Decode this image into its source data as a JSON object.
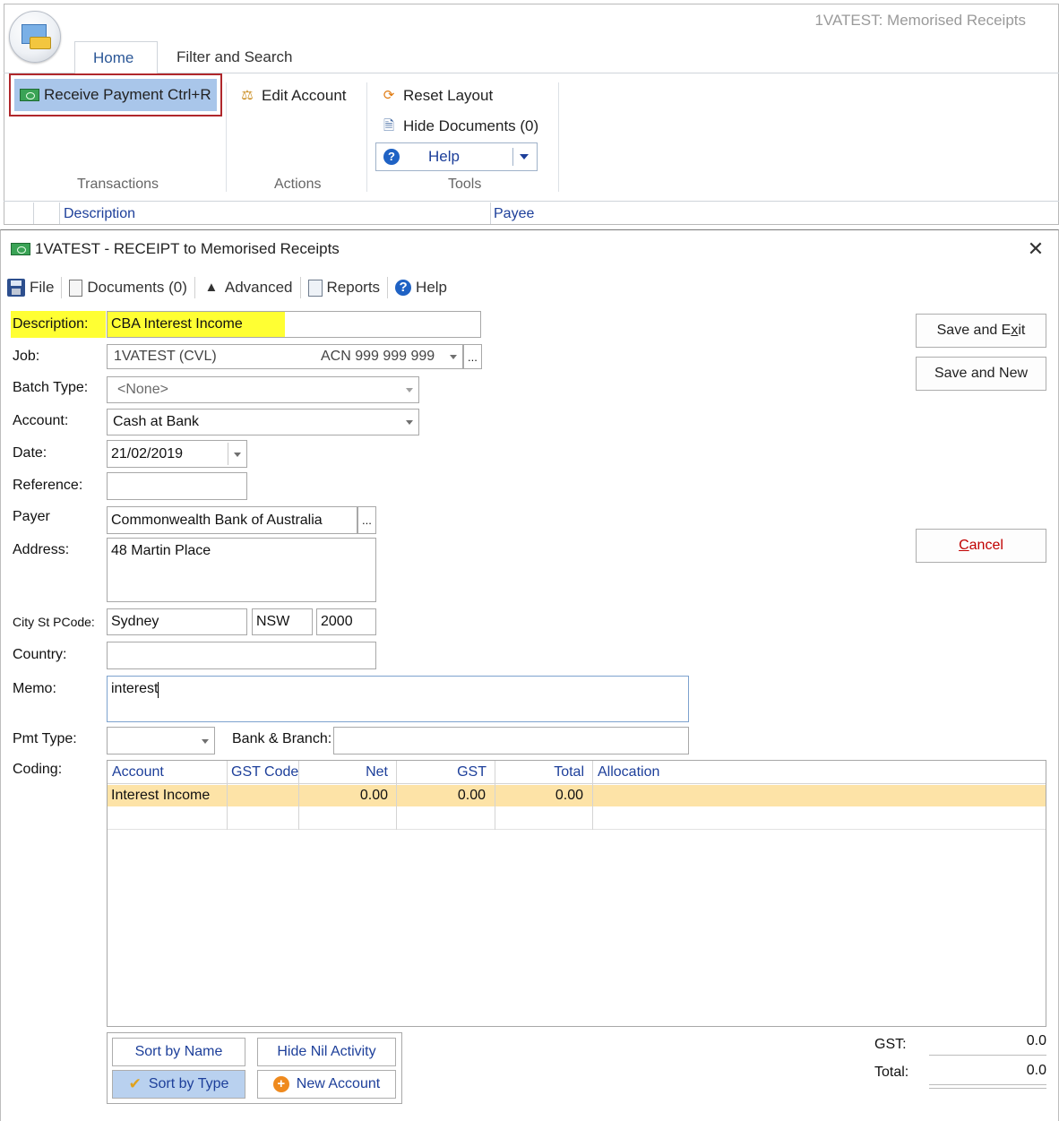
{
  "app": {
    "title": "1VATEST: Memorised Receipts",
    "tabs": [
      "Home",
      "Filter and Search"
    ],
    "ribbon": {
      "receive_payment": "Receive Payment Ctrl+R",
      "edit_account": "Edit Account",
      "reset_layout": "Reset Layout",
      "hide_documents": "Hide Documents (0)",
      "help": "Help",
      "groups": [
        "Transactions",
        "Actions",
        "Tools"
      ]
    },
    "grid_columns": [
      "Description",
      "Payee"
    ]
  },
  "dialog": {
    "title": "1VATEST - RECEIPT to Memorised Receipts",
    "toolbar": [
      "File",
      "Documents (0)",
      "Advanced",
      "Reports",
      "Help"
    ],
    "labels": {
      "description": "Description:",
      "job": "Job:",
      "batch_type": "Batch Type:",
      "account": "Account:",
      "date": "Date:",
      "reference": "Reference:",
      "payer": "Payer",
      "address": "Address:",
      "city_st_pcode": "City St PCode:",
      "country": "Country:",
      "memo": "Memo:",
      "pmt_type": "Pmt Type:",
      "bank_branch": "Bank & Branch:",
      "coding": "Coding:"
    },
    "values": {
      "description": "CBA Interest Income",
      "job_name": "1VATEST (CVL)",
      "job_acn": "ACN 999 999 999",
      "batch_type": "<None>",
      "account": "Cash at Bank",
      "date": "21/02/2019",
      "reference": "",
      "payer": "Commonwealth Bank of Australia",
      "address": "48 Martin Place",
      "city": "Sydney",
      "state": "NSW",
      "postcode": "2000",
      "country": "",
      "memo": "interest",
      "pmt_type": "",
      "bank_branch": ""
    },
    "buttons": {
      "save_exit_pre": "Save and E",
      "save_exit_u": "x",
      "save_exit_post": "it",
      "save_new": "Save and New",
      "cancel_u": "C",
      "cancel_post": "ancel",
      "ellipsis": "..."
    },
    "coding": {
      "columns": [
        "Account",
        "GST Code",
        "Net",
        "GST",
        "Total",
        "Allocation"
      ],
      "rows": [
        {
          "account": "Interest Income",
          "gst_code": "",
          "net": "0.00",
          "gst": "0.00",
          "total": "0.00",
          "allocation": ""
        }
      ]
    },
    "bottom_buttons": {
      "sort_by_name": "Sort by Name",
      "hide_nil_activity": "Hide Nil Activity",
      "sort_by_type": "Sort by Type",
      "new_account": "New Account"
    },
    "totals": {
      "gst_label": "GST:",
      "gst_value": "0.0",
      "total_label": "Total:",
      "total_value": "0.0"
    }
  },
  "colors": {
    "highlight": "#ffff33",
    "selected_row": "#fde3a7",
    "link_blue": "#1d3f9a",
    "receive_border": "#b0272b"
  }
}
